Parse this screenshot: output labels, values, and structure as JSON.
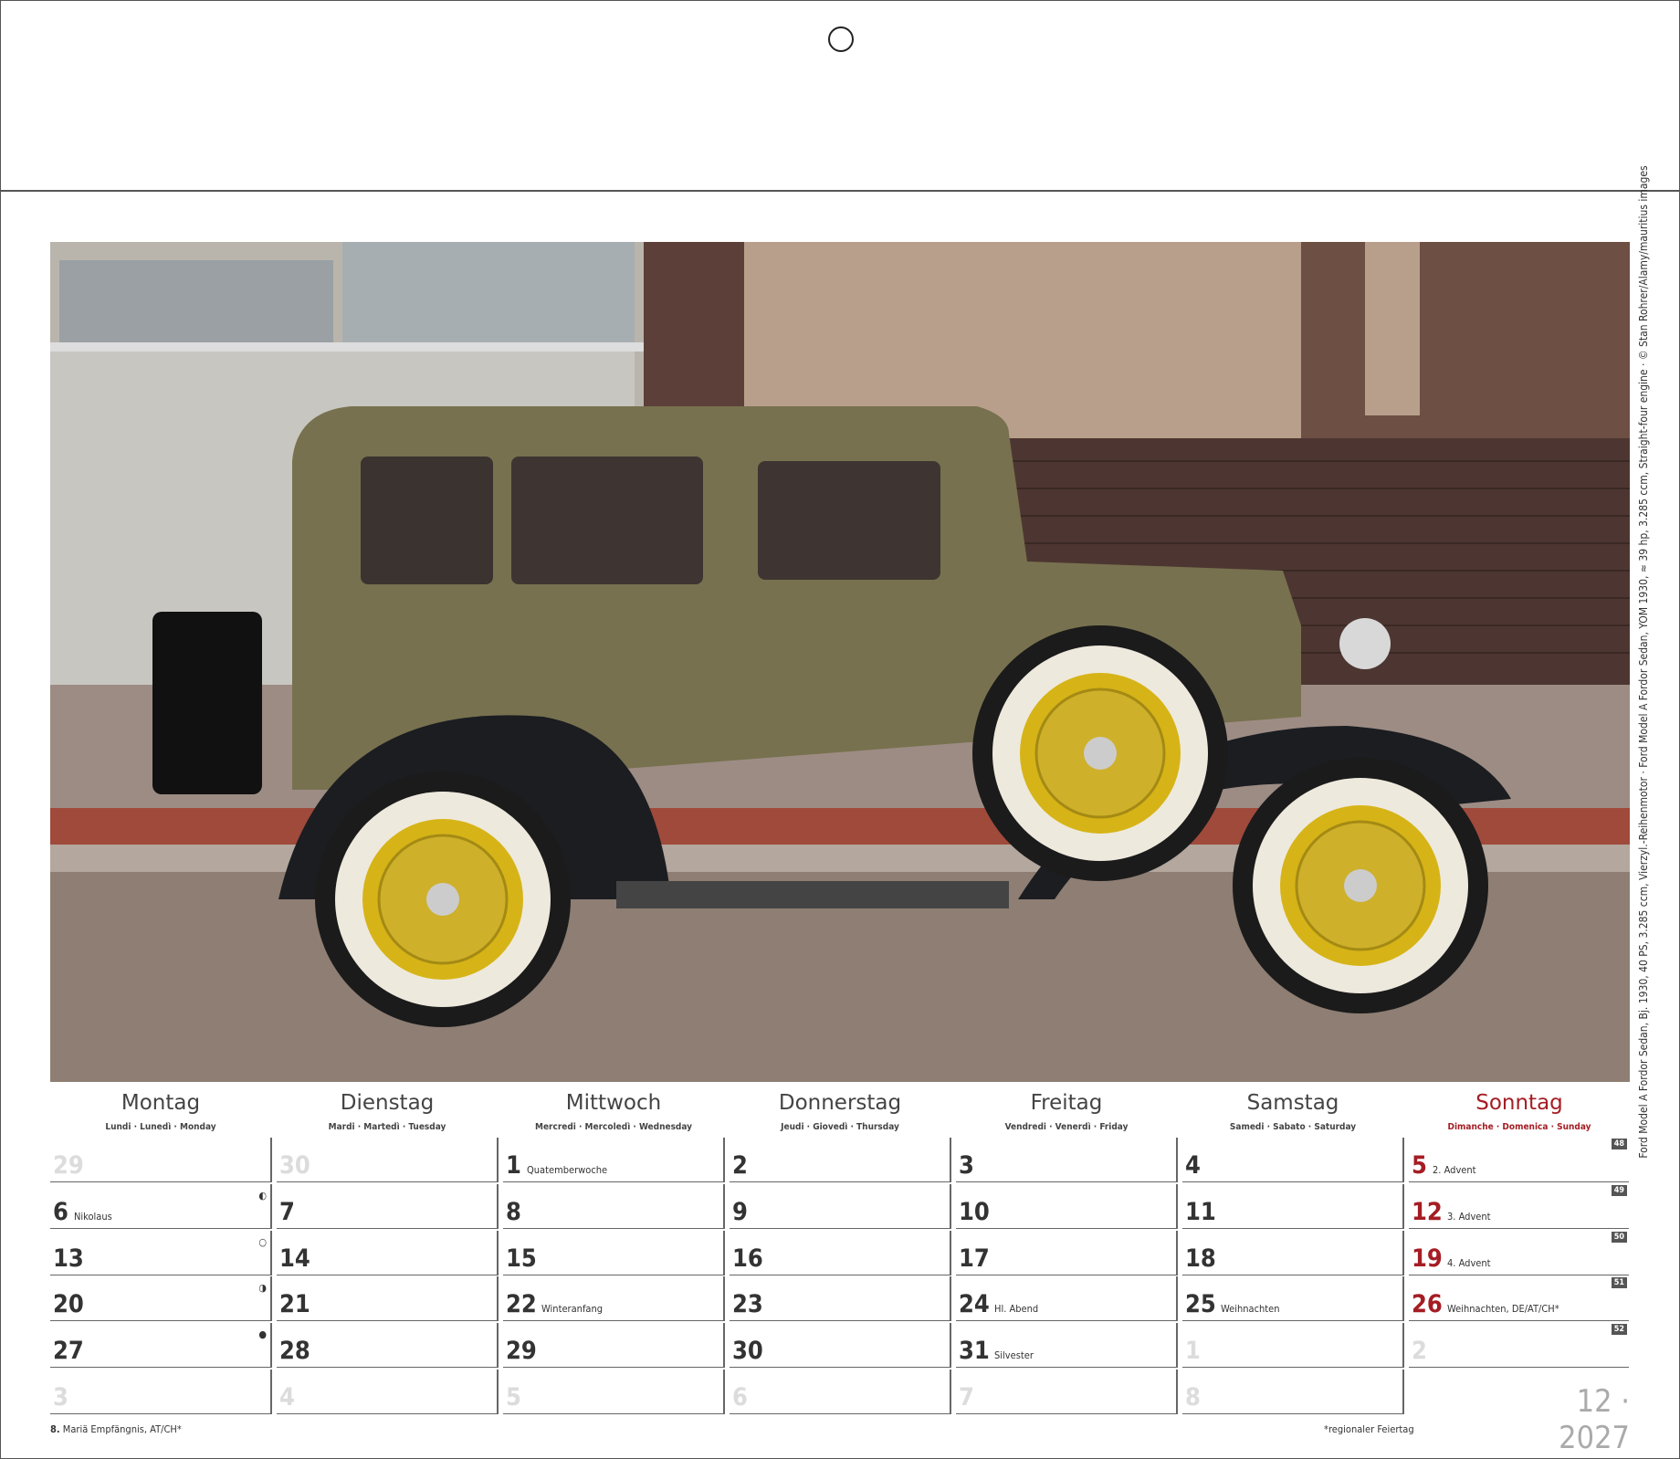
{
  "photo_credit": "Ford Model A Fordor Sedan, Bj. 1930, 40 PS, 3.285 ccm, Vierzyl.-Reihenmotor · Ford Model A Fordor Sedan, YOM 1930, ≈ 39 hp, 3.285 ccm, Straight-four engine · © Stan Rohrer/Alamy/mauritius images",
  "weekdays": [
    {
      "name": "Montag",
      "sub": "Lundi · Lunedì · Monday"
    },
    {
      "name": "Dienstag",
      "sub": "Mardi · Martedì · Tuesday"
    },
    {
      "name": "Mittwoch",
      "sub": "Mercredi · Mercoledì · Wednesday"
    },
    {
      "name": "Donnerstag",
      "sub": "Jeudi · Giovedì · Thursday"
    },
    {
      "name": "Freitag",
      "sub": "Vendredi · Venerdì · Friday"
    },
    {
      "name": "Samstag",
      "sub": "Samedi · Sabato · Saturday"
    },
    {
      "name": "Sonntag",
      "sub": "Dimanche · Domenica · Sunday"
    }
  ],
  "weeks": [
    {
      "kw": "48",
      "days": [
        {
          "n": "29",
          "faded": true
        },
        {
          "n": "30",
          "faded": true
        },
        {
          "n": "1",
          "note": "Quatemberwoche"
        },
        {
          "n": "2"
        },
        {
          "n": "3"
        },
        {
          "n": "4"
        },
        {
          "n": "5",
          "note": "2. Advent",
          "red": true
        }
      ]
    },
    {
      "kw": "49",
      "days": [
        {
          "n": "6",
          "note": "Nikolaus",
          "moon": "◐"
        },
        {
          "n": "7"
        },
        {
          "n": "8"
        },
        {
          "n": "9"
        },
        {
          "n": "10"
        },
        {
          "n": "11"
        },
        {
          "n": "12",
          "note": "3. Advent",
          "red": true
        }
      ]
    },
    {
      "kw": "50",
      "days": [
        {
          "n": "13",
          "moon": "○"
        },
        {
          "n": "14"
        },
        {
          "n": "15"
        },
        {
          "n": "16"
        },
        {
          "n": "17"
        },
        {
          "n": "18"
        },
        {
          "n": "19",
          "note": "4. Advent",
          "red": true
        }
      ]
    },
    {
      "kw": "51",
      "days": [
        {
          "n": "20",
          "moon": "◑"
        },
        {
          "n": "21"
        },
        {
          "n": "22",
          "note": "Winteranfang"
        },
        {
          "n": "23"
        },
        {
          "n": "24",
          "note": "Hl. Abend"
        },
        {
          "n": "25",
          "note": "Weihnachten"
        },
        {
          "n": "26",
          "note": "Weihnachten, DE/AT/CH*",
          "red": true
        }
      ]
    },
    {
      "kw": "52",
      "days": [
        {
          "n": "27",
          "moon": "●"
        },
        {
          "n": "28"
        },
        {
          "n": "29"
        },
        {
          "n": "30"
        },
        {
          "n": "31",
          "note": "Silvester"
        },
        {
          "n": "1",
          "faded": true
        },
        {
          "n": "2",
          "faded": true
        }
      ]
    },
    {
      "kw": "",
      "days": [
        {
          "n": "3",
          "faded": true
        },
        {
          "n": "4",
          "faded": true
        },
        {
          "n": "5",
          "faded": true
        },
        {
          "n": "6",
          "faded": true
        },
        {
          "n": "7",
          "faded": true
        },
        {
          "n": "8",
          "faded": true
        }
      ]
    }
  ],
  "month_year": "12 · 2027",
  "footnote_left_num": "8.",
  "footnote_left_text": " Mariä Empfängnis, AT/CH*",
  "footnote_right": "*regionaler Feiertag"
}
